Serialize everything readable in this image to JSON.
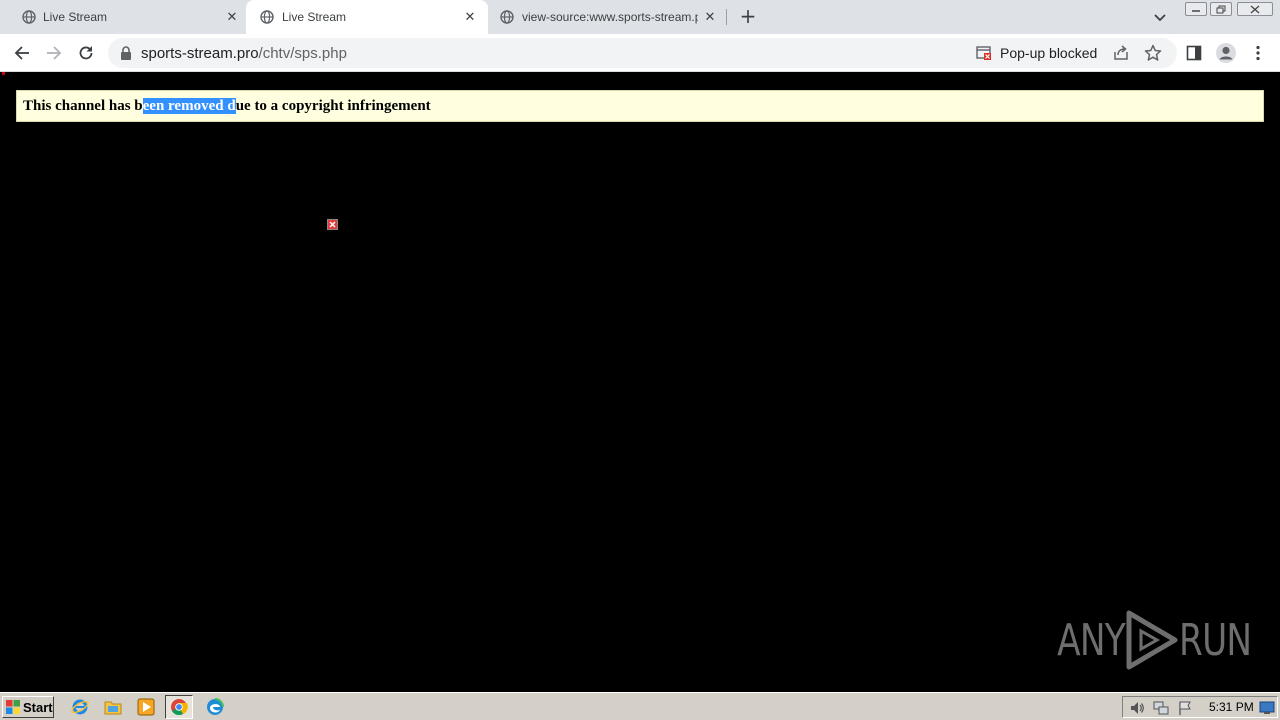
{
  "browser": {
    "tabs": [
      {
        "title": "Live Stream",
        "active": false
      },
      {
        "title": "Live Stream",
        "active": true
      },
      {
        "title": "view-source:www.sports-stream.pro",
        "active": false
      }
    ],
    "address": {
      "host": "sports-stream.pro",
      "path": "/chtv/sps.php"
    },
    "popup_blocked_label": "Pop-up blocked"
  },
  "page": {
    "notice": {
      "before": "This channel has b",
      "selected": "een removed d",
      "after": "ue to a copyright infringement"
    }
  },
  "watermark": {
    "left": "ANY",
    "right": "RUN"
  },
  "taskbar": {
    "start_label": "Start",
    "clock": "5:31 PM"
  },
  "colors": {
    "notice_background": "#ffffe0",
    "selection": "#3390ff",
    "page_background": "#000000",
    "tab_strip": "#dee1e6"
  }
}
